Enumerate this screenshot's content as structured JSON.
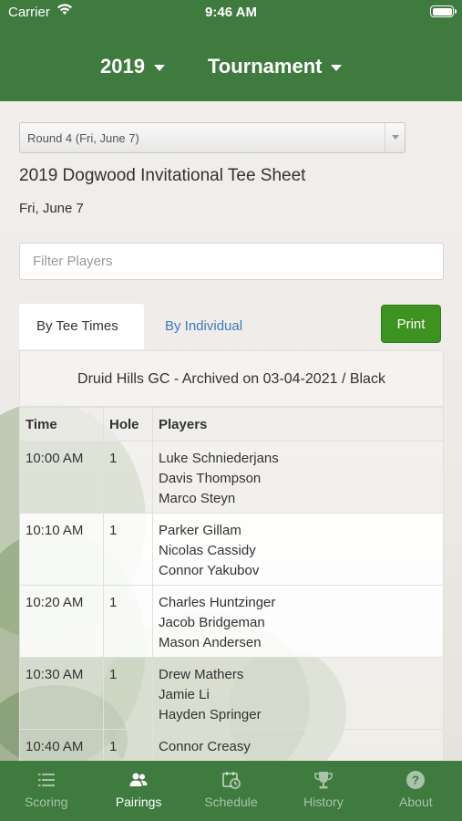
{
  "status_bar": {
    "carrier": "Carrier",
    "time": "9:46 AM"
  },
  "nav": {
    "year": "2019",
    "tournament": "Tournament"
  },
  "round_select": {
    "value": "Round 4 (Fri, June 7)"
  },
  "sheet": {
    "title": "2019 Dogwood Invitational Tee Sheet",
    "date": "Fri, June 7"
  },
  "filter": {
    "placeholder": "Filter Players"
  },
  "tabs": {
    "by_tee_times": "By Tee Times",
    "by_individual": "By Individual",
    "print": "Print"
  },
  "course_info": "Druid Hills GC - Archived on 03-04-2021 / Black",
  "table": {
    "headers": {
      "time": "Time",
      "hole": "Hole",
      "players": "Players"
    },
    "rows": [
      {
        "time": "10:00 AM",
        "hole": "1",
        "players": [
          "Luke Schniederjans",
          "Davis Thompson",
          "Marco Steyn"
        ]
      },
      {
        "time": "10:10 AM",
        "hole": "1",
        "players": [
          "Parker Gillam",
          "Nicolas Cassidy",
          "Connor Yakubov"
        ]
      },
      {
        "time": "10:20 AM",
        "hole": "1",
        "players": [
          "Charles Huntzinger",
          "Jacob Bridgeman",
          "Mason Andersen"
        ]
      },
      {
        "time": "10:30 AM",
        "hole": "1",
        "players": [
          "Drew Mathers",
          "Jamie Li",
          "Hayden Springer"
        ]
      },
      {
        "time": "10:40 AM",
        "hole": "1",
        "players": [
          "Connor Creasy",
          "",
          ""
        ]
      }
    ]
  },
  "tabbar": {
    "items": [
      {
        "label": "Scoring",
        "icon": "list-icon"
      },
      {
        "label": "Pairings",
        "icon": "people-icon"
      },
      {
        "label": "Schedule",
        "icon": "calendar-clock-icon"
      },
      {
        "label": "History",
        "icon": "trophy-icon"
      },
      {
        "label": "About",
        "icon": "question-circle-icon"
      }
    ],
    "active_index": 1
  },
  "colors": {
    "header_green": "#3f7a3e",
    "print_green": "#3d9320",
    "link_blue": "#3a7bbd"
  }
}
